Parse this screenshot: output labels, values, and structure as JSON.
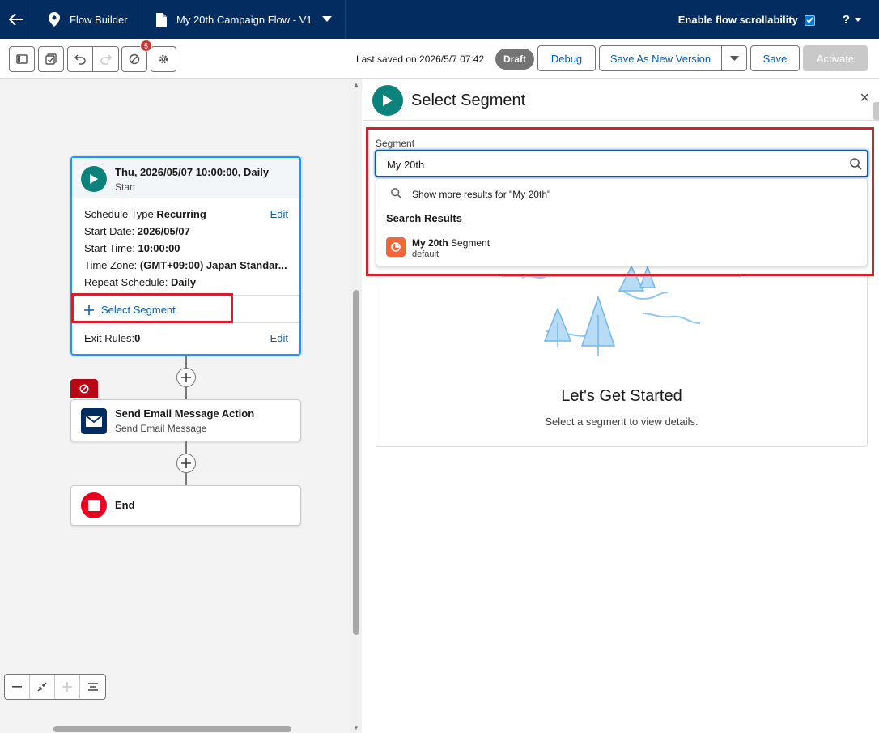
{
  "topbar": {
    "app_name": "Flow Builder",
    "flow_name": "My 20th Campaign Flow - V1",
    "scroll_toggle_label": "Enable flow scrollability",
    "help_label": "?"
  },
  "toolbar": {
    "last_saved": "Last saved on 2026/5/7 07:42",
    "status": "Draft",
    "debug": "Debug",
    "save_as_new_version": "Save As New Version",
    "save": "Save",
    "activate": "Activate",
    "error_count": "5"
  },
  "start_node": {
    "title": "Thu, 2026/05/07 10:00:00, Daily",
    "subtitle": "Start",
    "schedule_type_label": "Schedule Type:",
    "schedule_type_value": "Recurring",
    "start_date_label": "Start Date:",
    "start_date_value": "2026/05/07",
    "start_time_label": "Start Time:",
    "start_time_value": "10:00:00",
    "time_zone_label": "Time Zone:",
    "time_zone_value": "(GMT+09:00) Japan Standar...",
    "repeat_label": "Repeat Schedule:",
    "repeat_value": "Daily",
    "edit": "Edit",
    "select_segment": "Select Segment",
    "exit_rules_label": "Exit Rules:",
    "exit_rules_value": "0",
    "exit_edit": "Edit"
  },
  "action_node": {
    "title": "Send Email Message Action",
    "subtitle": "Send Email Message"
  },
  "end_node": {
    "title": "End"
  },
  "panel": {
    "title": "Select Segment",
    "close": "×",
    "segment_label": "Segment",
    "segment_value": "My 20th",
    "show_more": "Show more results for \"My 20th\"",
    "results_heading": "Search Results",
    "result_match": "My 20th",
    "result_rest": " Segment",
    "result_sub": "default",
    "empty_title": "Let's Get Started",
    "empty_sub": "Select a segment to view details."
  },
  "colors": {
    "header_bg": "#032d60",
    "start_icon": "#0b827c",
    "email_icon": "#032d60",
    "end_icon": "#ea001e",
    "highlight": "#d61f2c",
    "segment_icon": "#f2673a",
    "link": "#0b5cab"
  }
}
